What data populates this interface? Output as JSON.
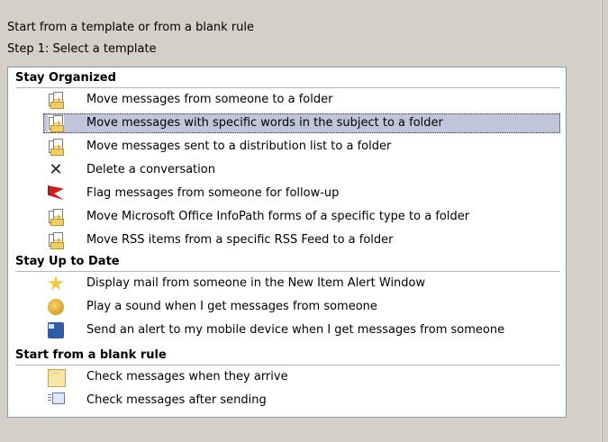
{
  "captions": {
    "line1": "Start from a template or from a blank rule",
    "line2": "Step 1: Select a template"
  },
  "groups": [
    {
      "header": "Stay Organized",
      "items": [
        {
          "icon": "move-to-folder-icon",
          "label": "Move messages from someone to a folder"
        },
        {
          "icon": "move-to-folder-icon",
          "label": "Move messages with specific words in the subject to a folder",
          "selected": true
        },
        {
          "icon": "move-to-folder-icon",
          "label": "Move messages sent to a distribution list to a folder"
        },
        {
          "icon": "delete-x-icon",
          "label": "Delete a conversation"
        },
        {
          "icon": "red-flag-icon",
          "label": "Flag messages from someone for follow-up"
        },
        {
          "icon": "move-to-folder-icon",
          "label": "Move Microsoft Office InfoPath forms of a specific type to a folder"
        },
        {
          "icon": "move-to-folder-icon",
          "label": "Move RSS items from a specific RSS Feed to a folder"
        }
      ]
    },
    {
      "header": "Stay Up to Date",
      "items": [
        {
          "icon": "new-item-alert-icon",
          "label": "Display mail from someone in the New Item Alert Window"
        },
        {
          "icon": "speaker-sound-icon",
          "label": "Play a sound when I get messages from someone"
        },
        {
          "icon": "mobile-device-icon",
          "label": "Send an alert to my mobile device when I get messages from someone"
        }
      ]
    },
    {
      "header": "Start from a blank rule",
      "items": [
        {
          "icon": "envelope-icon",
          "label": "Check messages when they arrive"
        },
        {
          "icon": "send-envelope-icon",
          "label": "Check messages after sending"
        }
      ]
    }
  ]
}
